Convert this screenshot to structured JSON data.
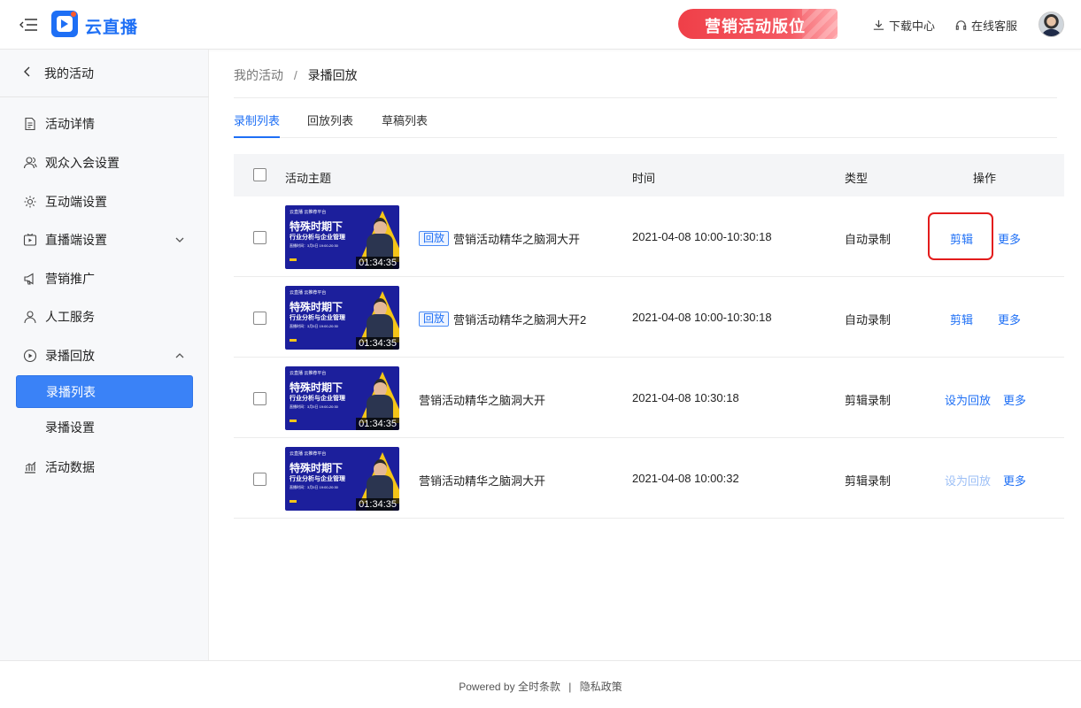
{
  "header": {
    "brand": "云直播",
    "promo": "营销活动版位",
    "download_center": "下载中心",
    "online_service": "在线客服"
  },
  "sidebar": {
    "back_label": "我的活动",
    "items": [
      {
        "label": "活动详情",
        "icon": "document-icon"
      },
      {
        "label": "观众入会设置",
        "icon": "users-icon"
      },
      {
        "label": "互动端设置",
        "icon": "settings-icon"
      },
      {
        "label": "直播端设置",
        "icon": "live-icon"
      },
      {
        "label": "营销推广",
        "icon": "megaphone-icon"
      },
      {
        "label": "人工服务",
        "icon": "person-icon"
      },
      {
        "label": "录播回放",
        "icon": "play-circle-icon"
      },
      {
        "label": "活动数据",
        "icon": "chart-icon"
      }
    ],
    "sub_items": [
      {
        "label": "录播列表",
        "active": true
      },
      {
        "label": "录播设置",
        "active": false
      }
    ]
  },
  "breadcrumb": {
    "parent": "我的活动",
    "separator": "/",
    "current": "录播回放"
  },
  "tabs": [
    {
      "label": "录制列表",
      "active": true
    },
    {
      "label": "回放列表",
      "active": false
    },
    {
      "label": "草稿列表",
      "active": false
    }
  ],
  "table": {
    "columns": {
      "topic": "活动主题",
      "time": "时间",
      "type": "类型",
      "action": "操作"
    },
    "thumbnail": {
      "top_text": "云直播 云推荐平台",
      "title": "特殊时期下",
      "subtitle": "行业分析与企业管理",
      "info": "直播时间：3月5日 19:00-20:30"
    },
    "rows": [
      {
        "badge": "回放",
        "title": "营销活动精华之脑洞大开",
        "time": "2021-04-08  10:00-10:30:18",
        "type": "自动录制",
        "duration": "01:34:35",
        "action1": "剪辑",
        "action2": "更多",
        "action1_disabled": false
      },
      {
        "badge": "回放",
        "title": "营销活动精华之脑洞大开2",
        "time": "2021-04-08  10:00-10:30:18",
        "type": "自动录制",
        "duration": "01:34:35",
        "action1": "剪辑",
        "action2": "更多",
        "action1_disabled": false
      },
      {
        "badge": "",
        "title": "营销活动精华之脑洞大开",
        "time": "2021-04-08 10:30:18",
        "type": "剪辑录制",
        "duration": "01:34:35",
        "action1": "设为回放",
        "action2": "更多",
        "action1_disabled": false
      },
      {
        "badge": "",
        "title": "营销活动精华之脑洞大开",
        "time": "2021-04-08  10:00:32",
        "type": "剪辑录制",
        "duration": "01:34:35",
        "action1": "设为回放",
        "action2": "更多",
        "action1_disabled": true
      }
    ]
  },
  "footer": {
    "powered": "Powered by",
    "terms": "全时条款",
    "separator": "|",
    "privacy": "隐私政策"
  },
  "colors": {
    "accent": "#1e6ff5",
    "active_nav": "#3a82f7",
    "highlight": "#e31c1c",
    "promo": "#ef3f48"
  }
}
